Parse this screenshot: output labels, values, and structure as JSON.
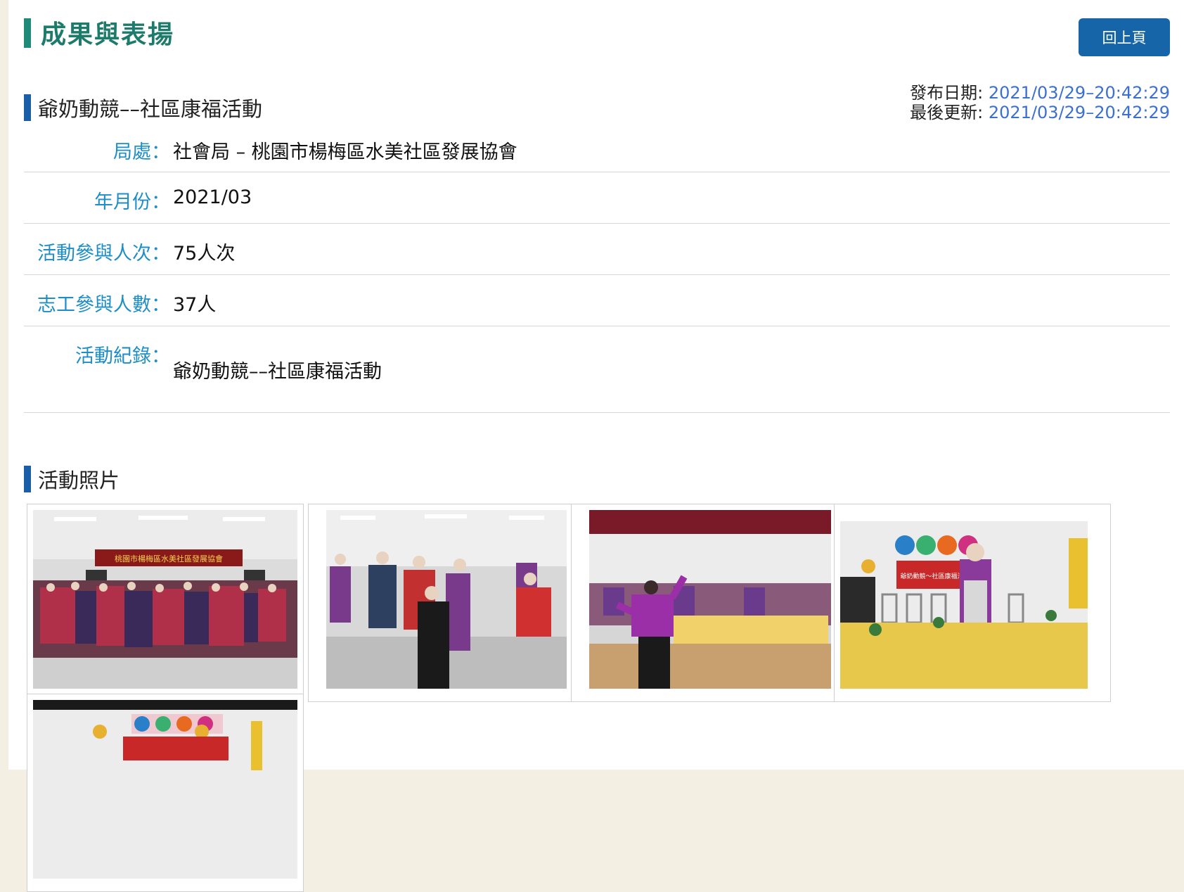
{
  "header": {
    "title": "成果與表揚",
    "back_label": "回上頁"
  },
  "article": {
    "title": "爺奶動競––社區康福活動",
    "published_label": "發布日期:",
    "published_value": "2021/03/29–20:42:29",
    "updated_label": "最後更新:",
    "updated_value": "2021/03/29–20:42:29"
  },
  "info": {
    "agency_label": "局處：",
    "agency_value": "社會局 – 桃園市楊梅區水美社區發展協會",
    "month_label": "年月份：",
    "month_value": "2021/03",
    "participants_label": "活動參與人次：",
    "participants_value": "75人次",
    "volunteers_label": "志工參與人數：",
    "volunteers_value": "37人",
    "record_label": "活動紀錄：",
    "record_value": "爺奶動競––社區康福活動"
  },
  "photos": {
    "title": "活動照片",
    "banner_text": "桃園市楊梅區水美社區發展協會",
    "sign_text": "爺奶動競〜社區康福活動"
  },
  "colors": {
    "teal_title": "#1d7b6b",
    "label_blue": "#1d8ec7",
    "date_blue": "#3b6fd0",
    "button_blue": "#1565a8",
    "bar_blue": "#1a5ea8"
  }
}
